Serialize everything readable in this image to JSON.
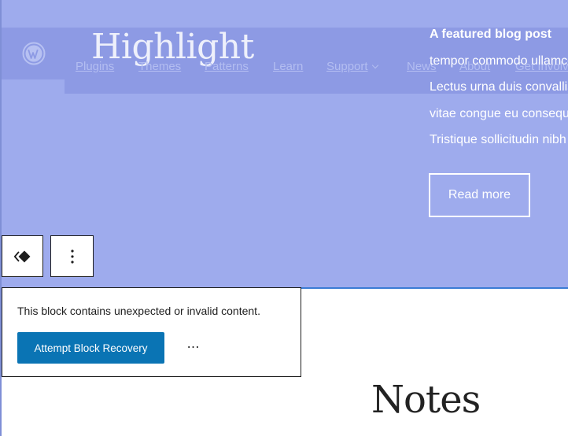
{
  "header": {
    "site_title": "Highlight",
    "nav": [
      {
        "label": "Plugins"
      },
      {
        "label": "Themes"
      },
      {
        "label": "Patterns"
      },
      {
        "label": "Learn"
      },
      {
        "label": "Support",
        "has_dropdown": true
      },
      {
        "label": "News"
      },
      {
        "label": "About"
      },
      {
        "label": "Get Involved"
      }
    ]
  },
  "featured_post": {
    "title": "A featured blog post",
    "lines": [
      "tempor commodo ullamcorper",
      "Lectus urna duis convallis",
      "vitae congue eu consequat",
      "Tristique sollicitudin nibh"
    ],
    "read_more_label": "Read more"
  },
  "block_toolbar": {
    "block_icon": "block-transform-icon",
    "options_icon": "more-vertical-icon"
  },
  "block_warning": {
    "message": "This block contains unexpected or invalid content.",
    "recover_label": "Attempt Block Recovery",
    "more_label": "⋯"
  },
  "next_block": {
    "heading": "Notes"
  },
  "colors": {
    "hero_bg": "#9eabed",
    "primary_button": "#0a74b4",
    "selection": "#3a7bd5"
  }
}
